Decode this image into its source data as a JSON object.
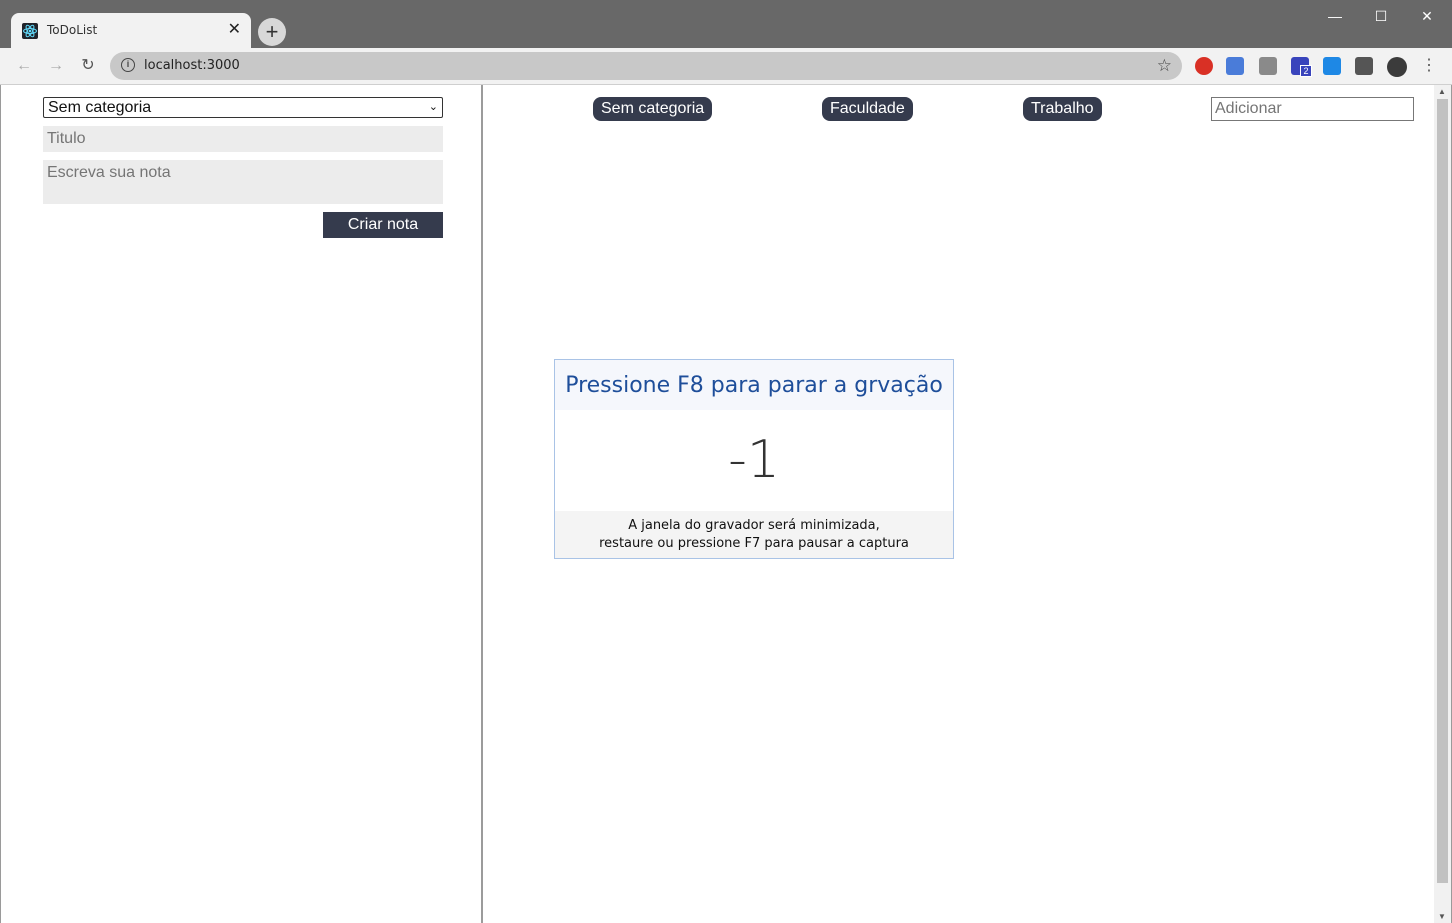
{
  "browser": {
    "tab_title": "ToDoList",
    "tab_close": "✕",
    "new_tab": "+",
    "window_controls": {
      "minimize": "—",
      "maximize": "☐",
      "close": "✕"
    },
    "nav": {
      "back": "←",
      "forward": "→",
      "reload": "↻"
    },
    "url": "localhost:3000",
    "info_icon": "i",
    "bookmark_icon": "☆",
    "menu_icon": "⋮",
    "extensions": [
      {
        "name": "ublock-icon",
        "color": "#d93025"
      },
      {
        "name": "translate-icon",
        "color": "#4a7cd9"
      },
      {
        "name": "screenshot-icon",
        "color": "#777777"
      },
      {
        "name": "extension-badge-icon",
        "color": "#3944bc",
        "badge": "2"
      },
      {
        "name": "kite-icon",
        "color": "#1e88e5"
      },
      {
        "name": "puzzle-icon",
        "color": "#555555"
      },
      {
        "name": "avatar-icon",
        "color": "#3b3b3b"
      }
    ]
  },
  "sidebar": {
    "category_select": "Sem categoria",
    "title_placeholder": "Titulo",
    "note_placeholder": "Escreva sua nota",
    "create_button": "Criar nota"
  },
  "main": {
    "categories": [
      "Sem categoria",
      "Faculdade",
      "Trabalho"
    ],
    "add_placeholder": "Adicionar"
  },
  "recorder": {
    "header": "Pressione F8 para parar a grvação",
    "countdown": "-1",
    "footer_line1": "A janela do gravador será minimizada,",
    "footer_line2": "restaure ou pressione F7 para pausar a captura"
  },
  "colors": {
    "pill_bg": "#353b4d",
    "titlebar": "#686868",
    "recorder_accent": "#1e4e9a"
  }
}
